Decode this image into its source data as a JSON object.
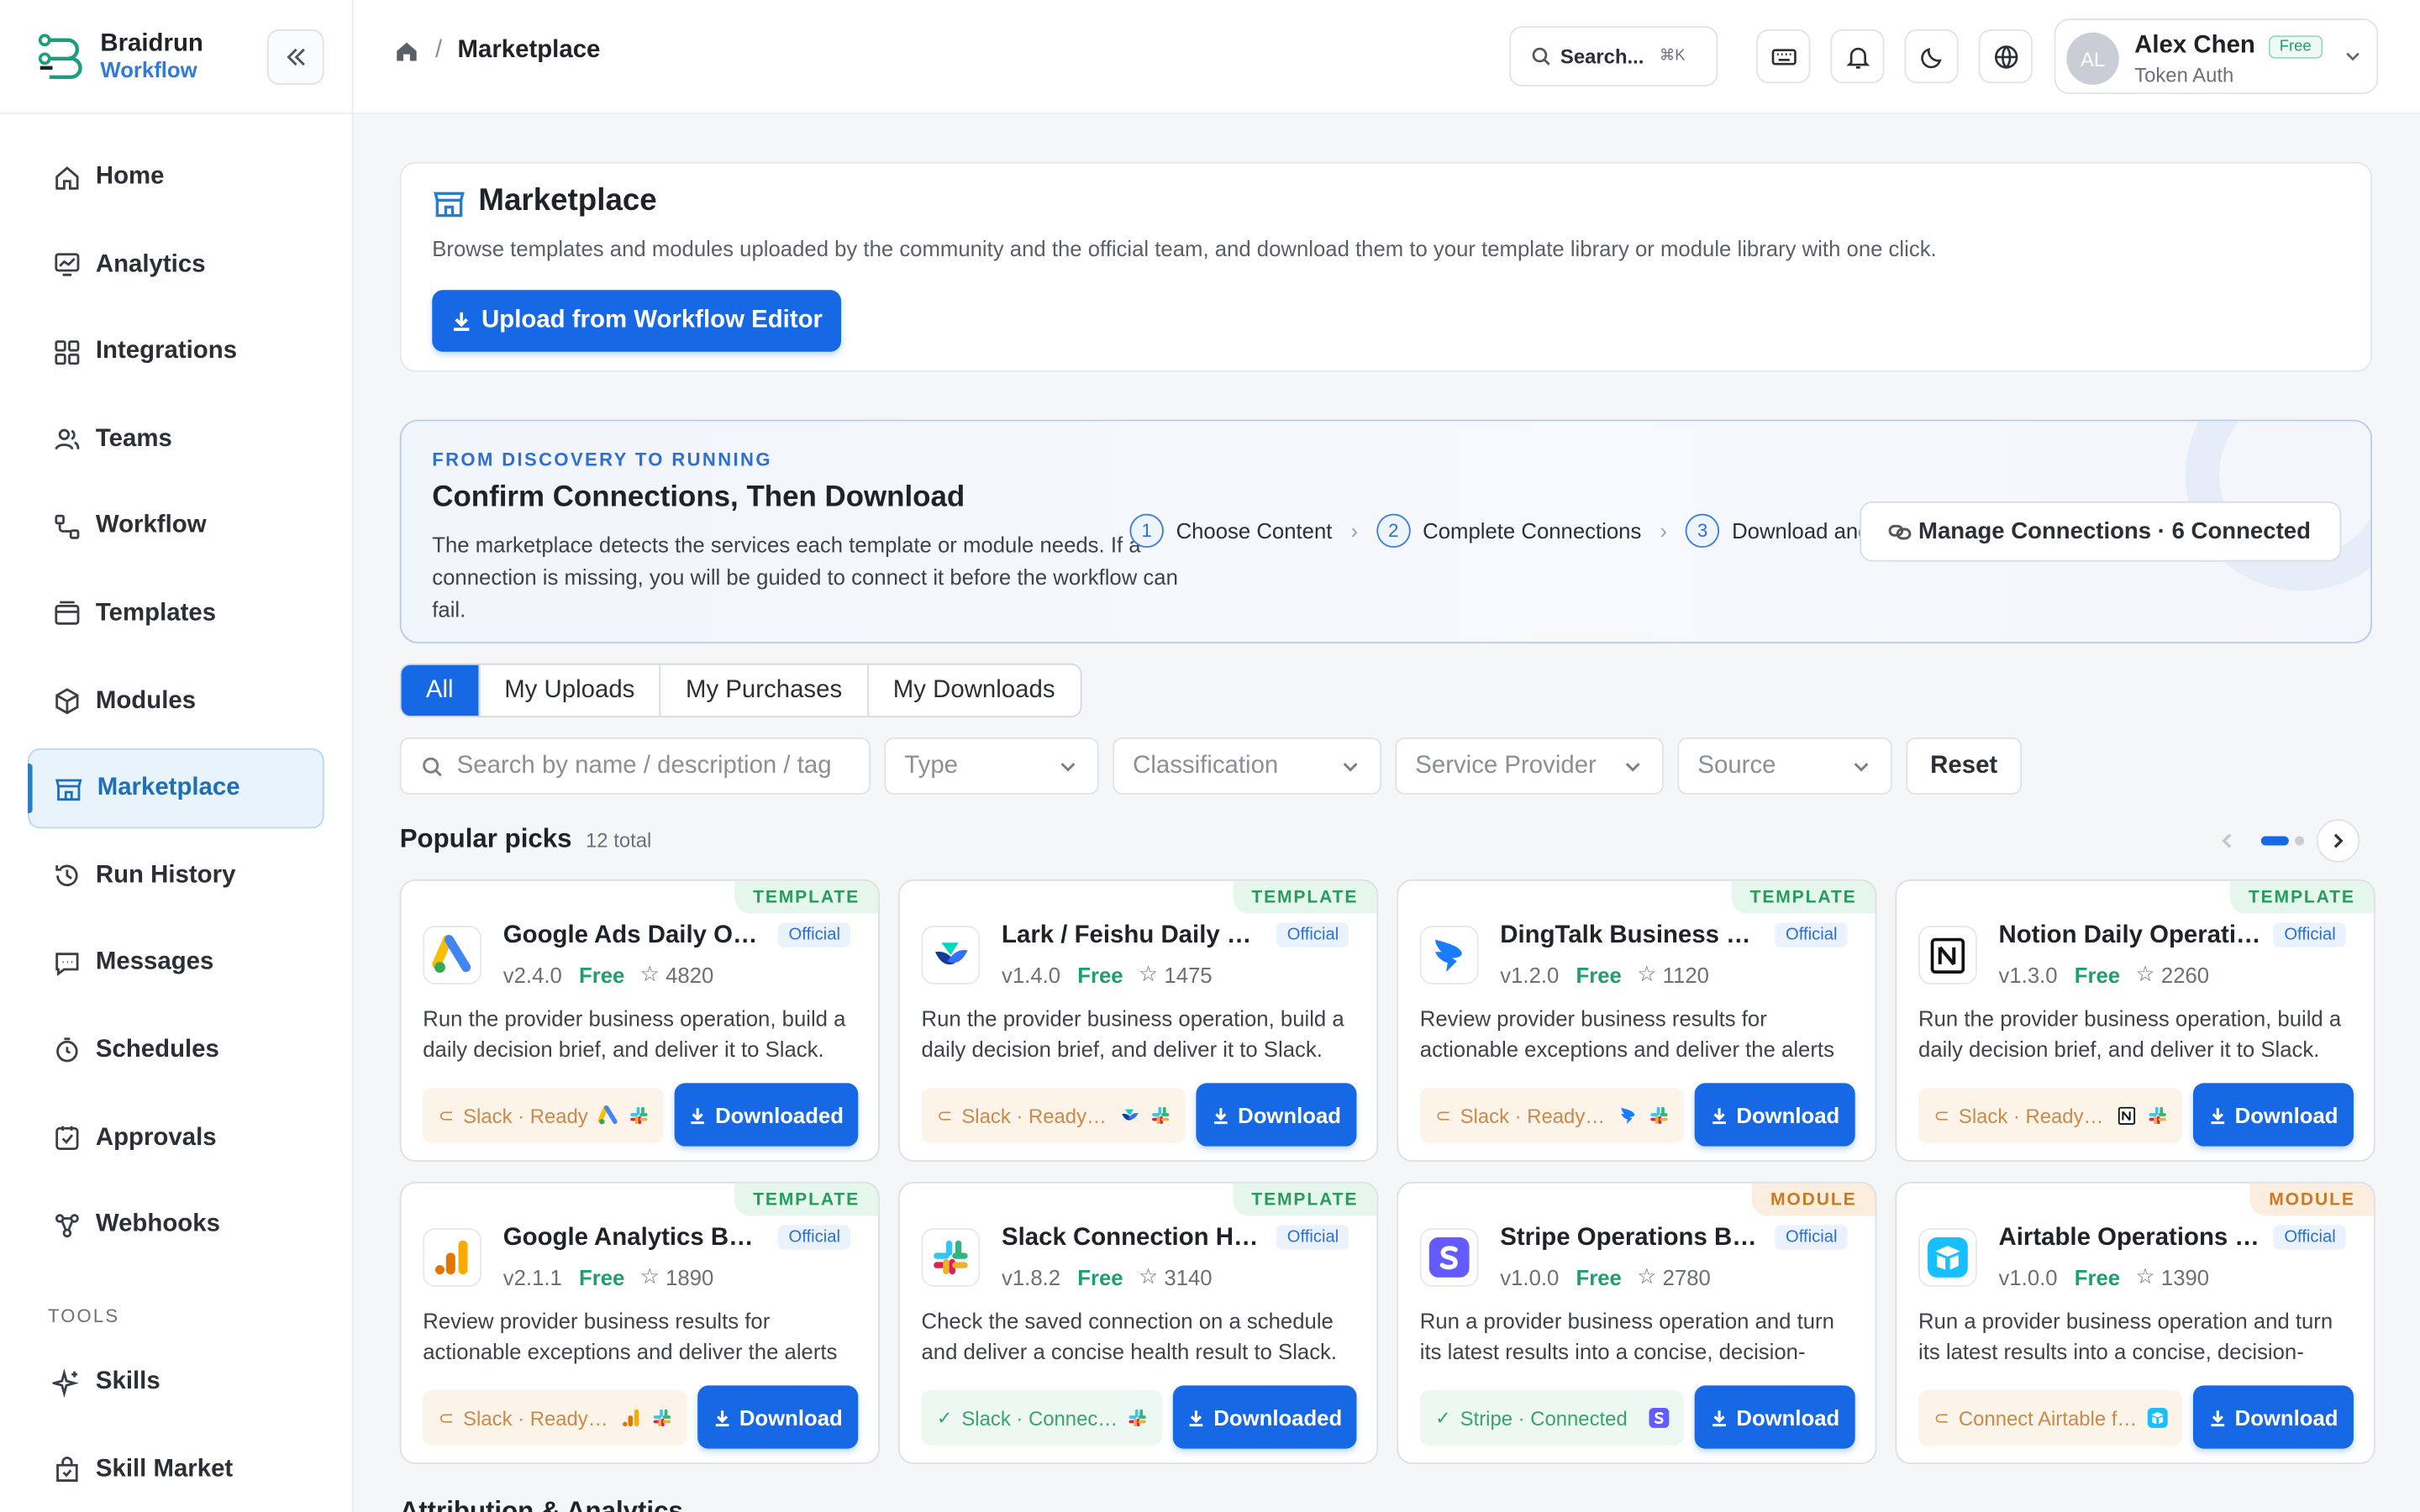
{
  "brand": {
    "name": "Braidrun",
    "sub": "Workflow"
  },
  "sidebar": {
    "items": [
      {
        "label": "Home",
        "icon": "home-icon"
      },
      {
        "label": "Analytics",
        "icon": "analytics-icon"
      },
      {
        "label": "Integrations",
        "icon": "integrations-icon"
      },
      {
        "label": "Teams",
        "icon": "teams-icon"
      },
      {
        "label": "Workflow",
        "icon": "workflow-icon"
      },
      {
        "label": "Templates",
        "icon": "templates-icon"
      },
      {
        "label": "Modules",
        "icon": "modules-icon"
      },
      {
        "label": "Marketplace",
        "icon": "store-icon",
        "active": true
      },
      {
        "label": "Run History",
        "icon": "history-icon"
      },
      {
        "label": "Messages",
        "icon": "messages-icon"
      },
      {
        "label": "Schedules",
        "icon": "timer-icon"
      },
      {
        "label": "Approvals",
        "icon": "approval-icon"
      },
      {
        "label": "Webhooks",
        "icon": "webhook-icon"
      }
    ],
    "tools_label": "TOOLS",
    "tools": [
      {
        "label": "Skills",
        "icon": "sparkle-icon"
      },
      {
        "label": "Skill Market",
        "icon": "bag-icon"
      }
    ]
  },
  "topbar": {
    "breadcrumb": "Marketplace",
    "search_label": "Search...",
    "search_shortcut": "⌘K",
    "user": {
      "initials": "AL",
      "name": "Alex Chen",
      "plan": "Free",
      "auth": "Token Auth"
    }
  },
  "hero": {
    "title": "Marketplace",
    "description": "Browse templates and modules uploaded by the community and the official team, and download them to your template library or module library with one click.",
    "button": "Upload from Workflow Editor"
  },
  "connections": {
    "kicker": "FROM DISCOVERY TO RUNNING",
    "title": "Confirm Connections, Then Download",
    "description": "The marketplace detects the services each template or module needs. If a connection is missing, you will be guided to connect it before the workflow can fail.",
    "steps": [
      {
        "num": "1",
        "label": "Choose Content"
      },
      {
        "num": "2",
        "label": "Complete Connections"
      },
      {
        "num": "3",
        "label": "Download and R"
      }
    ],
    "manage_button": "Manage Connections · 6 Connected"
  },
  "tabs": [
    "All",
    "My Uploads",
    "My Purchases",
    "My Downloads"
  ],
  "filters": {
    "search_placeholder": "Search by name / description / tag",
    "type": "Type",
    "classification": "Classification",
    "provider": "Service Provider",
    "source": "Source",
    "reset": "Reset"
  },
  "popular": {
    "title": "Popular picks",
    "count": "12 total"
  },
  "cards": [
    {
      "kind": "TEMPLATE",
      "title": "Google Ads Daily Operations Brief",
      "badge": "Official",
      "version": "v2.4.0",
      "price": "Free",
      "stars": "4820",
      "desc": "Run the provider business operation, build a daily decision brief, and deliver it to Slack.",
      "svc": "Slack · Ready",
      "svc_state": "warn",
      "logo": "google-ads",
      "action": "Downloaded"
    },
    {
      "kind": "TEMPLATE",
      "title": "Lark / Feishu Daily Operations Brief",
      "badge": "Official",
      "version": "v1.4.0",
      "price": "Free",
      "stars": "1475",
      "desc": "Run the provider business operation, build a daily decision brief, and deliver it to Slack.",
      "svc": "Slack · Ready to connect",
      "svc_state": "warn",
      "logo": "lark",
      "action": "Download"
    },
    {
      "kind": "TEMPLATE",
      "title": "DingTalk Business Exception Alerts",
      "badge": "Official",
      "version": "v1.2.0",
      "price": "Free",
      "stars": "1120",
      "desc": "Review provider business results for actionable exceptions and deliver the alerts to Slack.",
      "svc": "Slack · Ready to connect",
      "svc_state": "warn",
      "logo": "dingtalk",
      "action": "Download"
    },
    {
      "kind": "TEMPLATE",
      "title": "Notion Daily Operations Brief",
      "badge": "Official",
      "version": "v1.3.0",
      "price": "Free",
      "stars": "2260",
      "desc": "Run the provider business operation, build a daily decision brief, and deliver it to Slack.",
      "svc": "Slack · Ready to connect",
      "svc_state": "warn",
      "logo": "notion",
      "action": "Download"
    },
    {
      "kind": "TEMPLATE",
      "title": "Google Analytics Business Exception Alerts",
      "badge": "Official",
      "version": "v2.1.1",
      "price": "Free",
      "stars": "1890",
      "desc": "Review provider business results for actionable exceptions and deliver the alerts to Slack.",
      "svc": "Slack · Ready to connect",
      "svc_state": "warn",
      "logo": "google-analytics",
      "action": "Download"
    },
    {
      "kind": "TEMPLATE",
      "title": "Slack Connection Health Check",
      "badge": "Official",
      "version": "v1.8.2",
      "price": "Free",
      "stars": "3140",
      "desc": "Check the saved connection on a schedule and deliver a concise health result to Slack.",
      "svc": "Slack · Connected",
      "svc_state": "ok",
      "logo": "slack",
      "action": "Downloaded"
    },
    {
      "kind": "MODULE",
      "title": "Stripe Operations Brief",
      "badge": "Official",
      "version": "v1.0.0",
      "price": "Free",
      "stars": "2780",
      "desc": "Run a provider business operation and turn its latest results into a concise, decision-ready brief.",
      "svc": "Stripe · Connected",
      "svc_state": "ok",
      "logo": "stripe",
      "action": "Download"
    },
    {
      "kind": "MODULE",
      "title": "Airtable Operations Brief",
      "badge": "Official",
      "version": "v1.0.0",
      "price": "Free",
      "stars": "1390",
      "desc": "Run a provider business operation and turn its latest results into a concise, decision-ready brief.",
      "svc": "Connect Airtable first",
      "svc_state": "warn",
      "logo": "airtable",
      "action": "Download"
    }
  ],
  "next_section": "Attribution & Analytics",
  "colors": {
    "primary": "#1768e5",
    "accent": "#1f7fd3",
    "success": "#1f9e6e",
    "template_tag": "#2b9a5f",
    "module_tag": "#c87a24"
  }
}
